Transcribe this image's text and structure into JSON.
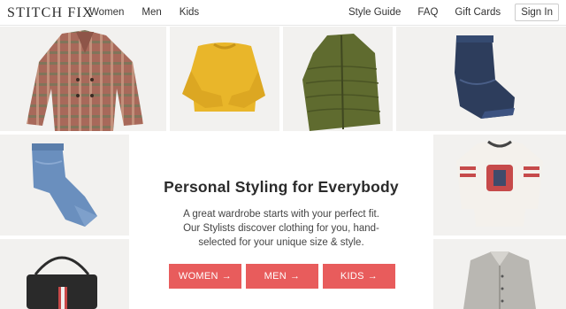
{
  "header": {
    "logo": "STITCH FIX",
    "nav_left": [
      "Women",
      "Men",
      "Kids"
    ],
    "nav_right": [
      "Style Guide",
      "FAQ",
      "Gift Cards"
    ],
    "signin_label": "Sign In"
  },
  "hero": {
    "title": "Personal Styling for Everybody",
    "body_lines": [
      "A great wardrobe starts with your perfect fit.",
      "Our Stylists discover clothing for you, hand-",
      "selected for your unique size & style."
    ],
    "buttons": [
      {
        "label": "WOMEN",
        "arrow": "→"
      },
      {
        "label": "MEN",
        "arrow": "→"
      },
      {
        "label": "KIDS",
        "arrow": "→"
      }
    ]
  },
  "colors": {
    "accent": "#e85c5c",
    "tile_bg": "#f2f1ef"
  },
  "tiles": [
    {
      "icon": "plaid-coat-image"
    },
    {
      "icon": "yellow-sweater-image"
    },
    {
      "icon": "green-puffer-jacket-image"
    },
    {
      "icon": "folded-jeans-image"
    },
    {
      "icon": "light-jeans-image"
    },
    {
      "icon": "kids-graphic-tee-image"
    },
    {
      "icon": "black-handbag-image"
    },
    {
      "icon": "gray-shirt-image"
    }
  ]
}
